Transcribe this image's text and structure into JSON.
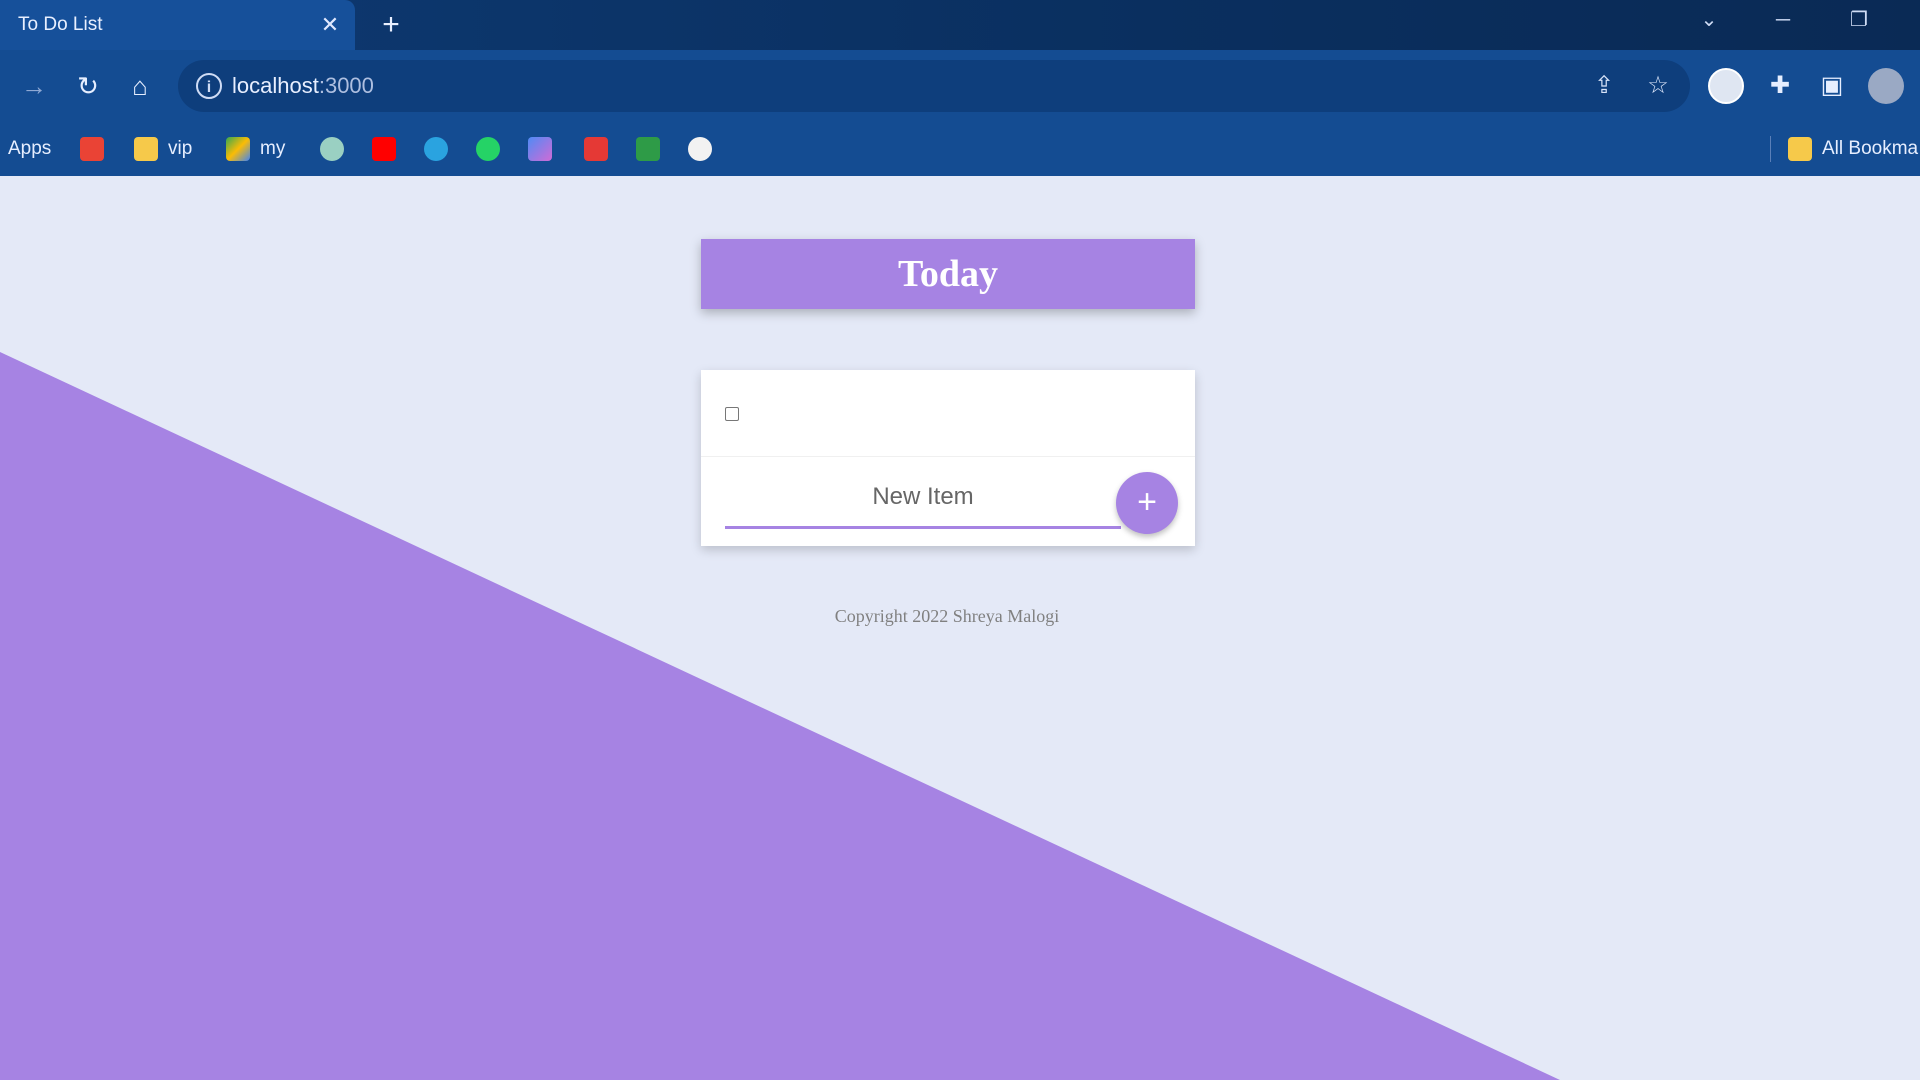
{
  "browser": {
    "tab_title": "To Do List",
    "tab_close": "✕",
    "new_tab": "+",
    "url": "localhost",
    "url_port": ":3000",
    "bookmarks": [
      {
        "label": "Apps"
      },
      {
        "label": "vip"
      },
      {
        "label": "my"
      },
      {
        "label": "All Bookma"
      }
    ]
  },
  "app": {
    "heading": "Today",
    "new_item_value": "New Item",
    "add_button": "+",
    "footer": "Copyright 2022 Shreya Malogi"
  },
  "colors": {
    "accent": "#a683e3",
    "background": "#e4e9f7",
    "chrome": "#144c92"
  }
}
